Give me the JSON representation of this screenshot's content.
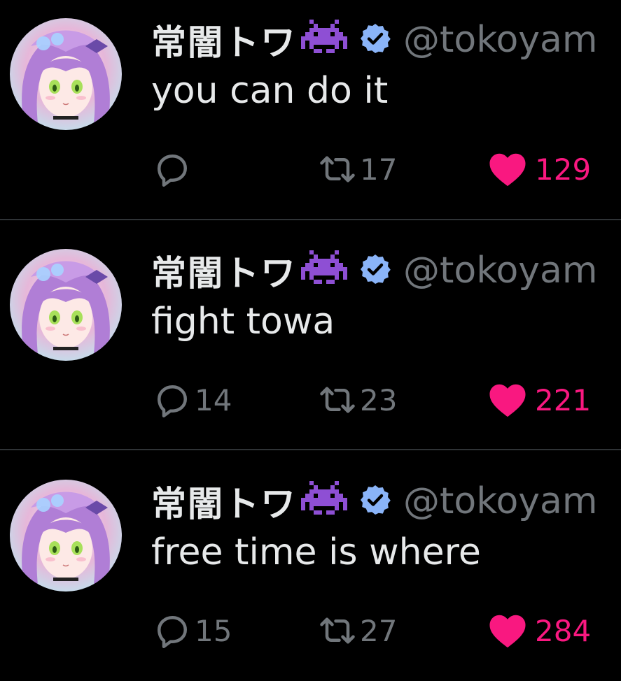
{
  "colors": {
    "background": "#000000",
    "text": "#e7e9ea",
    "muted": "#71767b",
    "like": "#f91880",
    "verified_badge": "#8ab4f8",
    "space_invader": "#8e4fd4",
    "divider": "#2f3336"
  },
  "icons": {
    "reply": "speech-bubble-icon",
    "retweet": "retweet-arrows-icon",
    "like": "heart-icon",
    "verified": "verified-badge-icon",
    "emoji": "space-invader-emoji"
  },
  "tweets": [
    {
      "display_name": "常闇トワ",
      "handle": "@tokoyam",
      "text": "you can do it",
      "replies": "",
      "retweets": "17",
      "likes": "129",
      "liked": true
    },
    {
      "display_name": "常闇トワ",
      "handle": "@tokoyam",
      "text": "fight towa",
      "replies": "14",
      "retweets": "23",
      "likes": "221",
      "liked": true
    },
    {
      "display_name": "常闇トワ",
      "handle": "@tokoyam",
      "text": "free time is where",
      "replies": "15",
      "retweets": "27",
      "likes": "284",
      "liked": true
    }
  ]
}
